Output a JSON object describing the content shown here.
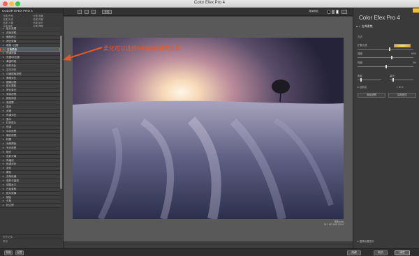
{
  "window": {
    "title": "Color Efex Pro 4"
  },
  "left": {
    "header": "COLOR EFEX PRO 4",
    "presets": [
      "分类 所有",
      "分类 收藏",
      "分类 历史",
      "分类 风景",
      "分类 人像",
      "分类 旅行",
      "分类 婚礼",
      "分类 建筑"
    ],
    "filters": [
      "胶片效果",
      "双色滤镜",
      "偏色修正",
      "漂白效果",
      "暗角 / 边框",
      "古典柔焦",
      "低调效果",
      "亮度/对比度",
      "黄金时段",
      "色彩对比",
      "交叉冲印",
      "详细提取滤镜",
      "黑暗对比",
      "图像边框",
      "胶片颗粒",
      "梦幻柔光",
      "渐变滤镜",
      "颜色渐变",
      "渐变雾",
      "高光",
      "浓度",
      "色调对比",
      "墨水",
      "红外胶片",
      "低调",
      "中灰滤镜",
      "偏光滤镜",
      "特殊",
      "深棕褐色",
      "天光滤镜",
      "阳光",
      "色彩分离",
      "风格化",
      "色调对比",
      "变化",
      "雾化",
      "去除色偏",
      "色阶与曲线",
      "调整水平",
      "白色柔焦",
      "胶片效果",
      "褪色",
      "夕阳",
      "拍立得"
    ],
    "selected_index": 5,
    "footer": [
      "历史记录",
      "预设"
    ]
  },
  "toolbar": {
    "buttons": [
      "单",
      "对比",
      "比较"
    ],
    "right_label": "背景颜色"
  },
  "annotation": {
    "text": "柔化可以选择Nik插件-古典柔焦"
  },
  "photo": {
    "caption_line1": "图像 jpeg",
    "caption_line2": "38.1 MP 3MB 100%"
  },
  "right": {
    "brand": "Color Efex Pro",
    "brand_version": "4",
    "panel_title": "古典柔焦",
    "rows": {
      "method": "方式",
      "diffusion": "扩散与亮",
      "strength": "强度",
      "brightness": "亮度",
      "shadows": "阴影",
      "highlights": "高光",
      "control_points": "控制点"
    },
    "values": {
      "strength": "60%",
      "brightness": "0%"
    },
    "buttons": {
      "add": "添加滤镜",
      "save": "保存配方"
    },
    "footer_link": "图像后置显示"
  },
  "bottom": {
    "left_buttons": [
      "帮助",
      "设置"
    ],
    "right_buttons": [
      "隐藏",
      "取消",
      "确定"
    ]
  }
}
